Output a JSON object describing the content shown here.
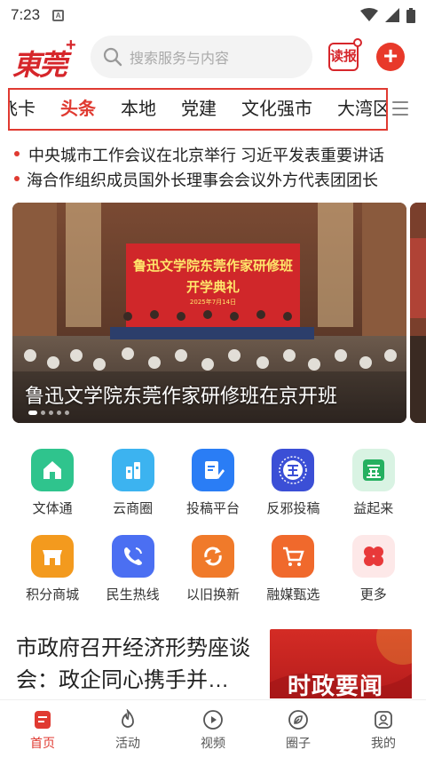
{
  "status": {
    "time": "7:23",
    "sim": "A"
  },
  "header": {
    "logo_text": "東莞",
    "logo_plus": "+",
    "search_placeholder": "搜索服务与内容",
    "read_label": "读报",
    "add_label": "+"
  },
  "tabs": [
    "飞卡",
    "头条",
    "本地",
    "党建",
    "文化强市",
    "大湾区"
  ],
  "active_tab": "头条",
  "headlines": [
    "中央城市工作会议在北京举行  习近平发表重要讲话",
    "海合作组织成员国外长理事会会议外方代表团团长"
  ],
  "banner": {
    "caption": "鲁迅文学院东莞作家研修班在京开班",
    "backdrop_line1": "鲁迅文学院东莞作家研修班",
    "backdrop_line2": "开学典礼",
    "backdrop_date": "2025年7月14日"
  },
  "services": [
    {
      "label": "文体通",
      "icon": "home-icon",
      "color": "#2fc48d"
    },
    {
      "label": "云商圈",
      "icon": "chart-bars-icon",
      "color": "#3cb3f0"
    },
    {
      "label": "投稿平台",
      "icon": "edit-doc-icon",
      "color": "#2a7df5"
    },
    {
      "label": "反邪投稿",
      "icon": "anti-cult-seal-icon",
      "color": "#3b4fd6"
    },
    {
      "label": "益起来",
      "icon": "charity-icon",
      "color": "#d9f3e3"
    },
    {
      "label": "积分商城",
      "icon": "shop-icon",
      "color": "#f39a1e"
    },
    {
      "label": "民生热线",
      "icon": "phone-icon",
      "color": "#4b6ff2"
    },
    {
      "label": "以旧换新",
      "icon": "recycle-icon",
      "color": "#f07a2a"
    },
    {
      "label": "融媒甄选",
      "icon": "cart-icon",
      "color": "#f0692c"
    },
    {
      "label": "更多",
      "icon": "clover-icon",
      "color": "#fde8e8"
    }
  ],
  "news": {
    "title": "市政府召开经济形势座谈会：政企同心携手并…",
    "thumb_text": "时政要闻"
  },
  "bottom_nav": [
    {
      "label": "首页",
      "icon": "home-doc-icon"
    },
    {
      "label": "活动",
      "icon": "flame-icon"
    },
    {
      "label": "视频",
      "icon": "play-icon"
    },
    {
      "label": "圈子",
      "icon": "leaf-icon"
    },
    {
      "label": "我的",
      "icon": "profile-icon"
    }
  ],
  "active_nav": "首页",
  "colors": {
    "brand": "#e03a31",
    "nav_active": "#e03a31"
  }
}
